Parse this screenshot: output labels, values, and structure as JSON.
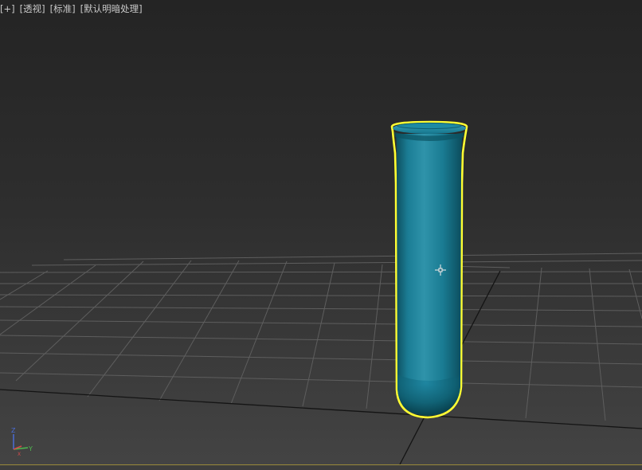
{
  "viewport": {
    "labels": {
      "plus": "[+]",
      "view": "[透视]",
      "shading": "[标准]",
      "lighting": "[默认明暗处理]"
    },
    "selected_object": "test-tube",
    "colors": {
      "object": "#1b7f97",
      "selection_outline": "#ffff33",
      "grid": "#5e5e5e",
      "grid_axis": "#111111"
    },
    "gizmo": {
      "z": "Z",
      "x": "X",
      "y": "Y"
    }
  }
}
